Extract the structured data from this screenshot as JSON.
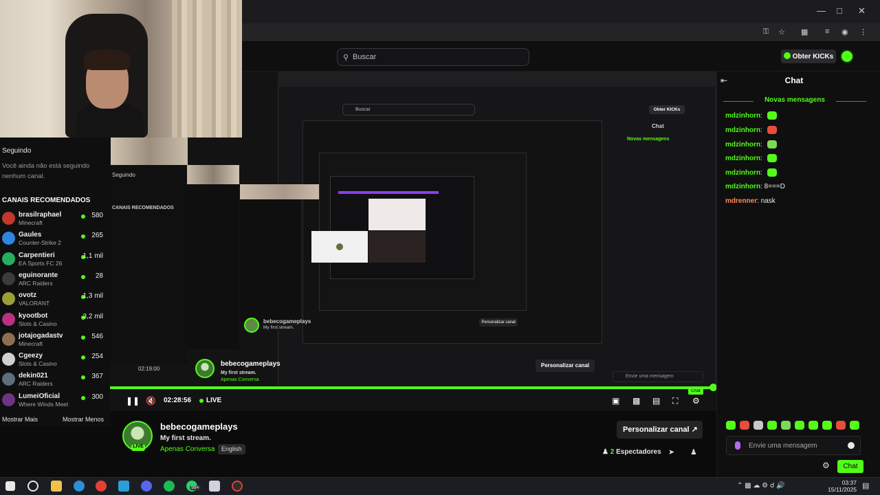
{
  "browser": {
    "search_placeholder": "Buscar",
    "kicks_label": "Obter KICKs"
  },
  "sidebar": {
    "following_heading": "Seguindo",
    "following_empty": "Você ainda não está seguindo nenhum canal.",
    "recommended_heading": "CANAIS RECOMENDADOS",
    "channels": [
      {
        "name": "brasilraphael",
        "category": "Minecraft",
        "viewers": "580",
        "color": "#c0392b"
      },
      {
        "name": "Gaules",
        "category": "Counter-Strike 2",
        "viewers": "265",
        "color": "#2e86de"
      },
      {
        "name": "Carpentieri",
        "category": "EA Sports FC 26",
        "viewers": "1,1 mil",
        "color": "#27ae60"
      },
      {
        "name": "eguinorante",
        "category": "ARC Raiders",
        "viewers": "28",
        "color": "#3b3b3b"
      },
      {
        "name": "ovotz",
        "category": "VALORANT",
        "viewers": "1,3 mil",
        "color": "#9aa035"
      },
      {
        "name": "kyootbot",
        "category": "Slots & Casino",
        "viewers": "3,2 mil",
        "color": "#b83280"
      },
      {
        "name": "jotajogadastv",
        "category": "Minecraft",
        "viewers": "546",
        "color": "#8e6e53"
      },
      {
        "name": "Cgeezy",
        "category": "Slots & Casino",
        "viewers": "254",
        "color": "#d0d0d0"
      },
      {
        "name": "dekin021",
        "category": "ARC Raiders",
        "viewers": "367",
        "color": "#5d6d7e"
      },
      {
        "name": "LumeiOficial",
        "category": "Where Winds Meet",
        "viewers": "300",
        "color": "#6c3483"
      }
    ],
    "show_more": "Mostrar Mais",
    "show_less": "Mostrar Menos"
  },
  "player": {
    "time": "02:28:56",
    "live_label": "LIVE",
    "nested_time": "02:19:00"
  },
  "stream_info": {
    "streamer": "bebecogameplays",
    "title": "My first stream.",
    "category": "Apenas Conversa",
    "language": "English",
    "live_badge": "LIVE",
    "personalize_label": "Personalizar canal",
    "viewers_count": "2",
    "viewers_label": "Espectadores"
  },
  "chat": {
    "title": "Chat",
    "new_messages": "Novas mensagens",
    "messages": [
      {
        "user": "mdzinhorn",
        "text": "",
        "emote": "#53fc18"
      },
      {
        "user": "mdzinhorn",
        "text": "",
        "emote": "#e74c3c"
      },
      {
        "user": "mdzinhorn",
        "text": "",
        "emote": "#7ed957"
      },
      {
        "user": "mdzinhorn",
        "text": "",
        "emote": "#53fc18"
      },
      {
        "user": "mdzinhorn",
        "text": "",
        "emote": "#53fc18"
      },
      {
        "user": "mdzinhorn",
        "text": "8===D",
        "emote": ""
      },
      {
        "user": "mdrenner",
        "text": "nask",
        "emote": ""
      }
    ],
    "input_placeholder": "Envie uma mensagem",
    "send_label": "Chat"
  },
  "taskbar": {
    "time": "03:37",
    "date": "15/11/2025",
    "badge": "99+"
  },
  "colors": {
    "accent": "#53fc18",
    "background": "#0f0f10"
  }
}
